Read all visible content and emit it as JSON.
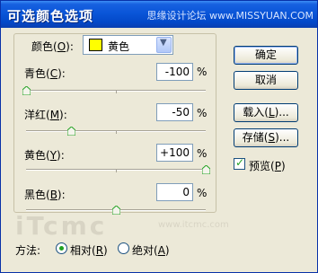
{
  "window": {
    "title": "可选颜色选项",
    "watermark": "思缘设计论坛 www.MISSYUAN.COM"
  },
  "color_select": {
    "label_prefix": "颜色(",
    "label_key": "O",
    "label_suffix": "):",
    "value": "黄色",
    "swatch_color": "#ffff00"
  },
  "sliders": [
    {
      "label_prefix": "青色(",
      "key": "C",
      "label_suffix": "):",
      "value": "-100",
      "unit": "%",
      "level_percent": -100
    },
    {
      "label_prefix": "洋红(",
      "key": "M",
      "label_suffix": "):",
      "value": "-50",
      "unit": "%",
      "level_percent": -50
    },
    {
      "label_prefix": "黄色(",
      "key": "Y",
      "label_suffix": "):",
      "value": "+100",
      "unit": "%",
      "level_percent": 100
    },
    {
      "label_prefix": "黑色(",
      "key": "B",
      "label_suffix": "):",
      "value": "0",
      "unit": "%",
      "level_percent": 0
    }
  ],
  "buttons": {
    "ok": "确定",
    "cancel": "取消",
    "load_prefix": "载入(",
    "load_key": "L",
    "load_suffix": ")...",
    "save_prefix": "存储(",
    "save_key": "S",
    "save_suffix": ")..."
  },
  "preview": {
    "prefix": "预览(",
    "key": "P",
    "suffix": ")",
    "checked": true
  },
  "method": {
    "label": "方法:",
    "relative_prefix": "相对(",
    "relative_key": "R",
    "relative_suffix": ")",
    "absolute_prefix": "绝对(",
    "absolute_key": "A",
    "absolute_suffix": ")",
    "selected": "relative"
  },
  "logo_text": "iTcmc",
  "logo_subtext": "www.itcmc.com"
}
